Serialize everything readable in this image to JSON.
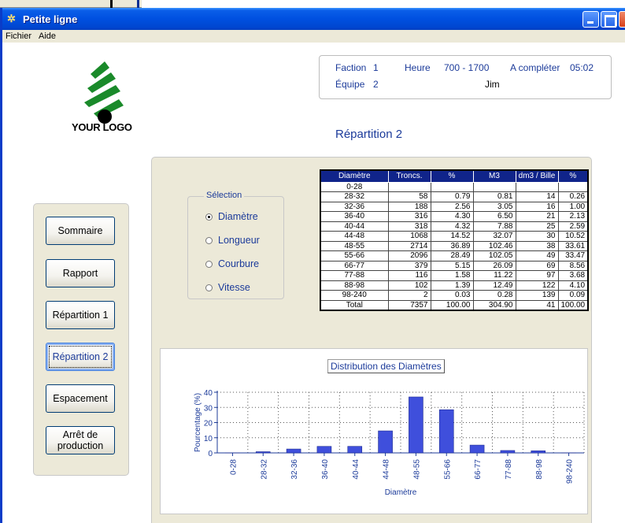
{
  "window": {
    "title": "Petite ligne"
  },
  "menu": [
    "Fichier",
    "Aide"
  ],
  "logo": {
    "text": "YOUR LOGO"
  },
  "info": {
    "faction_label": "Faction",
    "faction_value": "1",
    "heure_label": "Heure",
    "heure_value": "700 - 1700",
    "completer_label": "A compléter",
    "completer_value": "05:02",
    "equipe_label": "Équipe",
    "equipe_value": "2",
    "operator": "Jim"
  },
  "page_title": "Répartition 2",
  "nav": [
    {
      "label": "Sommaire"
    },
    {
      "label": "Rapport"
    },
    {
      "label": "Répartition 1"
    },
    {
      "label": "Répartition 2",
      "active": true
    },
    {
      "label": "Espacement"
    },
    {
      "label": "Arrêt de production"
    }
  ],
  "selection": {
    "legend": "Sélection",
    "options": [
      "Diamètre",
      "Longueur",
      "Courbure",
      "Vitesse"
    ],
    "selected": "Diamètre"
  },
  "table": {
    "headers": [
      "Diamètre",
      "Troncs.",
      "%",
      "M3",
      "dm3 / Bille",
      "%"
    ],
    "rows": [
      [
        "0-28",
        "",
        "",
        "",
        "",
        ""
      ],
      [
        "28-32",
        "58",
        "0.79",
        "0.81",
        "14",
        "0.26"
      ],
      [
        "32-36",
        "188",
        "2.56",
        "3.05",
        "16",
        "1.00"
      ],
      [
        "36-40",
        "316",
        "4.30",
        "6.50",
        "21",
        "2.13"
      ],
      [
        "40-44",
        "318",
        "4.32",
        "7.88",
        "25",
        "2.59"
      ],
      [
        "44-48",
        "1068",
        "14.52",
        "32.07",
        "30",
        "10.52"
      ],
      [
        "48-55",
        "2714",
        "36.89",
        "102.46",
        "38",
        "33.61"
      ],
      [
        "55-66",
        "2096",
        "28.49",
        "102.05",
        "49",
        "33.47"
      ],
      [
        "66-77",
        "379",
        "5.15",
        "26.09",
        "69",
        "8.56"
      ],
      [
        "77-88",
        "116",
        "1.58",
        "11.22",
        "97",
        "3.68"
      ],
      [
        "88-98",
        "102",
        "1.39",
        "12.49",
        "122",
        "4.10"
      ],
      [
        "98-240",
        "2",
        "0.03",
        "0.28",
        "139",
        "0.09"
      ],
      [
        "Total",
        "7357",
        "100.00",
        "304.90",
        "41",
        "100.00"
      ]
    ]
  },
  "chart_data": {
    "type": "bar",
    "title": "Distribution des Diamètres",
    "xlabel": "Diamètre",
    "ylabel": "Pourcentage (%)",
    "categories": [
      "0-28",
      "28-32",
      "32-36",
      "36-40",
      "40-44",
      "44-48",
      "48-55",
      "55-66",
      "66-77",
      "77-88",
      "88-98",
      "98-240"
    ],
    "values": [
      0,
      0.79,
      2.56,
      4.3,
      4.32,
      14.52,
      36.89,
      28.49,
      5.15,
      1.58,
      1.39,
      0.03
    ],
    "ylim": [
      0,
      40
    ],
    "yticks": [
      0,
      10,
      20,
      30,
      40
    ],
    "grid": true,
    "colors": {
      "bar": "#3f4fdc",
      "axis": "#1c3b9a"
    }
  }
}
